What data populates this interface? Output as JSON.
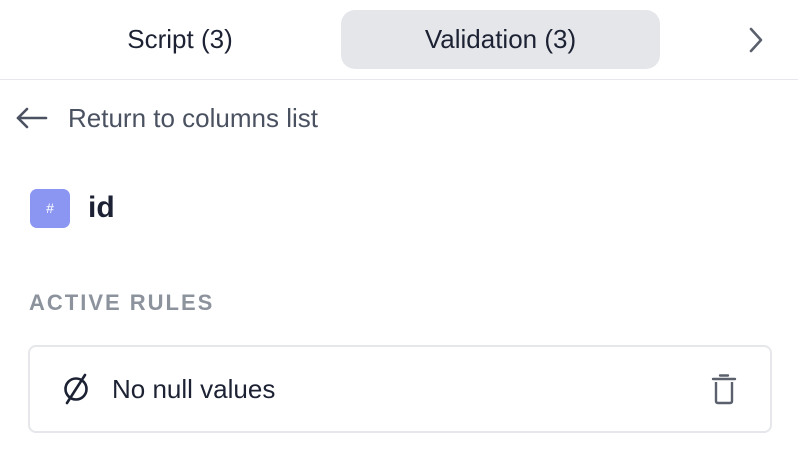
{
  "tabs": {
    "script_label": "Script (3)",
    "validation_label": "Validation (3)",
    "next_icon": "chevron-right-icon"
  },
  "back": {
    "label": "Return to columns list",
    "icon": "arrow-left-icon"
  },
  "column": {
    "type_symbol": "#",
    "name": "id"
  },
  "rules_section": {
    "title": "ACTIVE RULES"
  },
  "rules": [
    {
      "label": "No null values",
      "icon": "empty-set-icon",
      "delete_icon": "trash-icon"
    }
  ],
  "colors": {
    "active_tab_bg": "#e5e6ea",
    "type_badge_bg": "#8b96f2",
    "muted_text": "#8d939d",
    "border": "#e6e7ea"
  }
}
